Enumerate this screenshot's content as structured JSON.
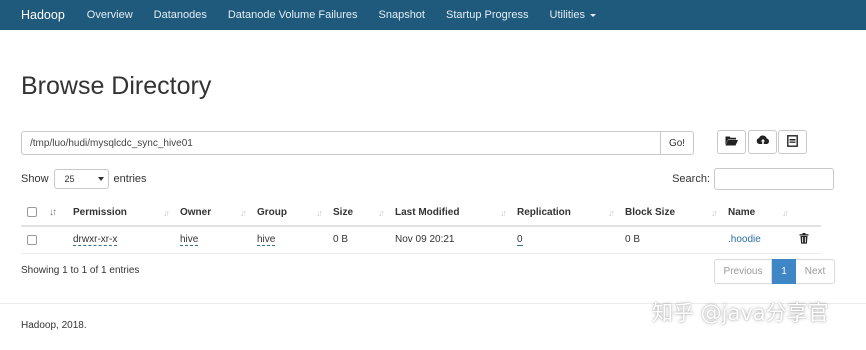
{
  "navbar": {
    "brand": "Hadoop",
    "items": [
      "Overview",
      "Datanodes",
      "Datanode Volume Failures",
      "Snapshot",
      "Startup Progress",
      "Utilities"
    ]
  },
  "page": {
    "title": "Browse Directory"
  },
  "path_bar": {
    "path_value": "/tmp/luo/hudi/mysqlcdc_sync_hive01",
    "go_label": "Go!",
    "icons": [
      "folder-open-icon",
      "cloud-upload-icon",
      "list-icon"
    ]
  },
  "controls": {
    "show_label": "Show",
    "page_size": "25",
    "entries_label": "entries",
    "search_label": "Search:"
  },
  "table": {
    "columns": [
      "Permission",
      "Owner",
      "Group",
      "Size",
      "Last Modified",
      "Replication",
      "Block Size",
      "Name"
    ],
    "rows": [
      {
        "permission": "drwxr-xr-x",
        "owner": "hive",
        "group": "hive",
        "size": "0 B",
        "last_modified": "Nov 09 20:21",
        "replication": "0",
        "block_size": "0 B",
        "name": ".hoodie"
      }
    ]
  },
  "info": {
    "text": "Showing 1 to 1 of 1 entries"
  },
  "pagination": {
    "previous": "Previous",
    "current": "1",
    "next": "Next"
  },
  "footer": {
    "text": "Hadoop, 2018."
  },
  "watermark": {
    "text": "知乎 @java分享官"
  },
  "colors": {
    "navbar_bg": "#1f5a7d",
    "link": "#2a6fa3",
    "page_active": "#3f86c7"
  }
}
